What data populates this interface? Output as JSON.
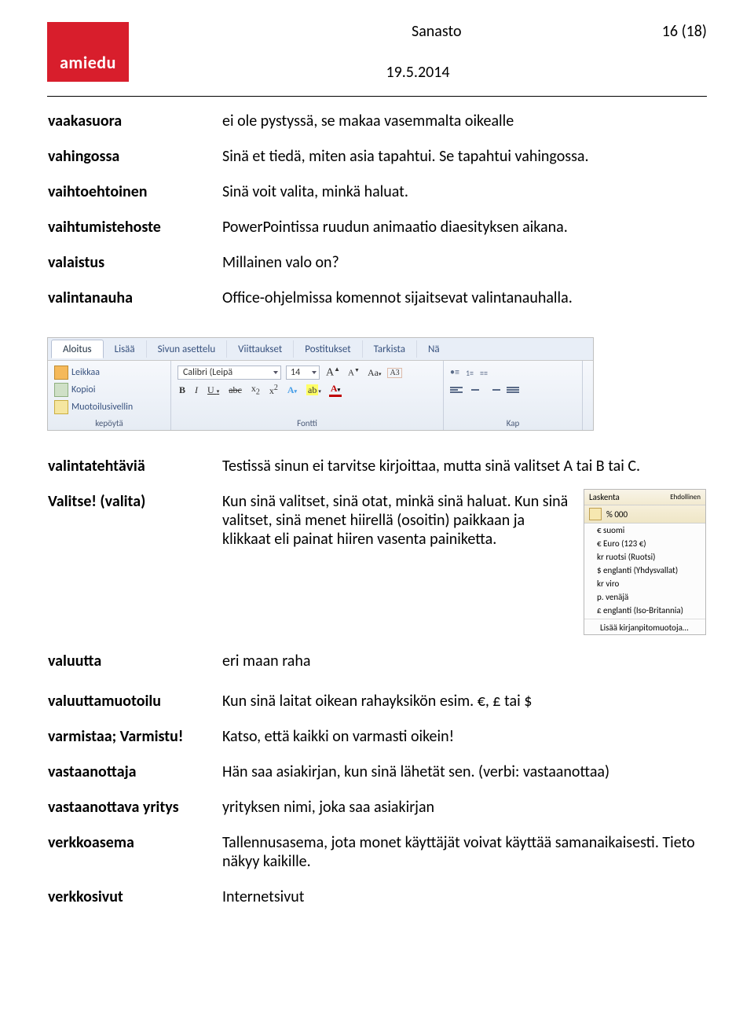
{
  "header": {
    "logo_text": "amiedu",
    "title": "Sanasto",
    "page_indicator": "16 (18)",
    "date": "19.5.2014"
  },
  "entries_top": [
    {
      "term": "vaakasuora",
      "def": "ei ole pystyssä, se makaa vasemmalta oikealle"
    },
    {
      "term": "vahingossa",
      "def": "Sinä et tiedä, miten asia tapahtui. Se tapahtui vahingossa."
    },
    {
      "term": "vaihtoehtoinen",
      "def": "Sinä voit valita, minkä haluat."
    },
    {
      "term": "vaihtumistehoste",
      "def": "PowerPointissa ruudun animaatio diaesityksen aikana."
    },
    {
      "term": "valaistus",
      "def": "Millainen valo on?"
    },
    {
      "term": "valintanauha",
      "def": "Office-ohjelmissa komennot sijaitsevat valintanauhalla."
    }
  ],
  "ribbon": {
    "tabs": [
      "Aloitus",
      "Lisää",
      "Sivun asettelu",
      "Viittaukset",
      "Postitukset",
      "Tarkista",
      "Nä"
    ],
    "clipboard": {
      "cut": "Leikkaa",
      "copy": "Kopioi",
      "brush": "Muotoilusivellin",
      "group_label": "kepöytä"
    },
    "font": {
      "name": "Calibri (Leipä",
      "size": "14",
      "group_label": "Fontti"
    },
    "paragraph_label": "Kap"
  },
  "entries_mid": [
    {
      "term": "valintatehtäviä",
      "def": "Testissä sinun ei tarvitse kirjoittaa, mutta sinä valitset A tai B tai C."
    },
    {
      "term": "Valitse! (valita)",
      "def": "Kun sinä valitset, sinä otat, minkä sinä haluat. Kun sinä valitset, sinä menet hiirellä (osoitin) paikkaan ja klikkaat eli painat hiiren vasenta painiketta."
    },
    {
      "term": "valuutta",
      "def": "eri maan raha"
    }
  ],
  "currency_menu": {
    "header": "Laskenta",
    "sub": "% 000",
    "right": "Ehdollinen",
    "items": [
      "€ suomi",
      "€ Euro (123 €)",
      "kr ruotsi (Ruotsi)",
      "$ englanti (Yhdysvallat)",
      "kr viro",
      "p. venäjä",
      "£ englanti (Iso-Britannia)"
    ],
    "footer": "Lisää kirjanpitomuotoja…"
  },
  "entries_bottom": [
    {
      "term": "valuuttamuotoilu",
      "def": "Kun sinä laitat oikean rahayksikön esim. €, £ tai $"
    },
    {
      "term": "varmistaa; Varmistu!",
      "def": "Katso, että kaikki on varmasti oikein!"
    },
    {
      "term": "vastaanottaja",
      "def": "Hän saa asiakirjan, kun sinä lähetät sen. (verbi: vastaanottaa)"
    },
    {
      "term": "vastaanottava yritys",
      "def": "yrityksen nimi, joka saa asiakirjan"
    },
    {
      "term": "verkkoasema",
      "def": "Tallennusasema, jota monet käyttäjät voivat käyttää samanaikaisesti. Tieto näkyy kaikille."
    },
    {
      "term": "verkkosivut",
      "def": "Internetsivut"
    }
  ]
}
